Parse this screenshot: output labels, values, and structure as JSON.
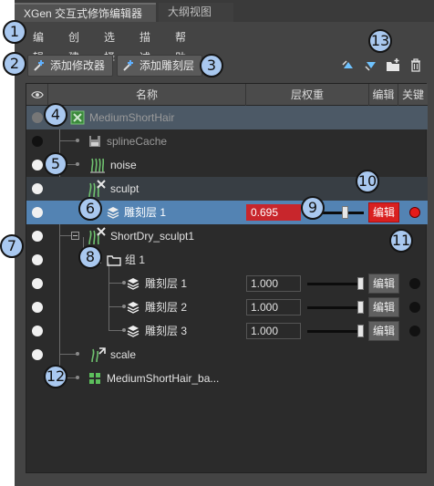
{
  "window": {
    "tabs": [
      {
        "label": "XGen 交互式修饰编辑器",
        "active": true
      },
      {
        "label": "大纲视图",
        "active": false
      }
    ]
  },
  "menu": [
    "编辑",
    "创建",
    "选择",
    "描述",
    "帮助"
  ],
  "toolbar": {
    "add_modifier": "添加修改器",
    "add_sculpt_layer": "添加雕刻层",
    "icons": [
      "move-up-icon",
      "move-down-icon",
      "new-folder-icon",
      "delete-icon"
    ]
  },
  "columns": {
    "visibility_icon": "eye-icon",
    "name": "名称",
    "layer_weight": "层权重",
    "edit": "编辑",
    "keyframe": "关键帧"
  },
  "rows": [
    {
      "name": "MediumShortHair",
      "icon": "xgen-description-icon",
      "visibility": "gray"
    },
    {
      "name": "splineCache",
      "icon": "save-icon",
      "visibility": "black"
    },
    {
      "name": "noise",
      "icon": "noise-modifier-icon",
      "visibility": "white"
    },
    {
      "name": "sculpt",
      "icon": "sculpt-modifier-icon",
      "visibility": "white"
    },
    {
      "name": "雕刻层 1",
      "icon": "layer-icon",
      "visibility": "white",
      "weight": "0.695",
      "weight_fraction": 0.695,
      "edit": "编辑",
      "key_active": true,
      "selected": true
    },
    {
      "name": "ShortDry_sculpt1",
      "icon": "sculpt-modifier-icon",
      "visibility": "white"
    },
    {
      "name": "组 1",
      "icon": "folder-icon",
      "visibility": "white"
    },
    {
      "name": "雕刻层 1",
      "icon": "layer-icon",
      "visibility": "white",
      "weight": "1.000",
      "weight_fraction": 1.0,
      "edit": "编辑",
      "key_active": false
    },
    {
      "name": "雕刻层 2",
      "icon": "layer-icon",
      "visibility": "white",
      "weight": "1.000",
      "weight_fraction": 1.0,
      "edit": "编辑",
      "key_active": false
    },
    {
      "name": "雕刻层 3",
      "icon": "layer-icon",
      "visibility": "white",
      "weight": "1.000",
      "weight_fraction": 1.0,
      "edit": "编辑",
      "key_active": false
    },
    {
      "name": "scale",
      "icon": "scale-modifier-icon",
      "visibility": "white"
    },
    {
      "name": "MediumShortHair_ba...",
      "icon": "grid-icon",
      "visibility": "none"
    }
  ],
  "callouts": [
    "1",
    "2",
    "3",
    "4",
    "5",
    "6",
    "7",
    "8",
    "9",
    "10",
    "11",
    "12",
    "13"
  ],
  "colors": {
    "selection": "#5383b3",
    "highlight_red": "#d92020",
    "callout_fill": "#a9c8ef"
  }
}
